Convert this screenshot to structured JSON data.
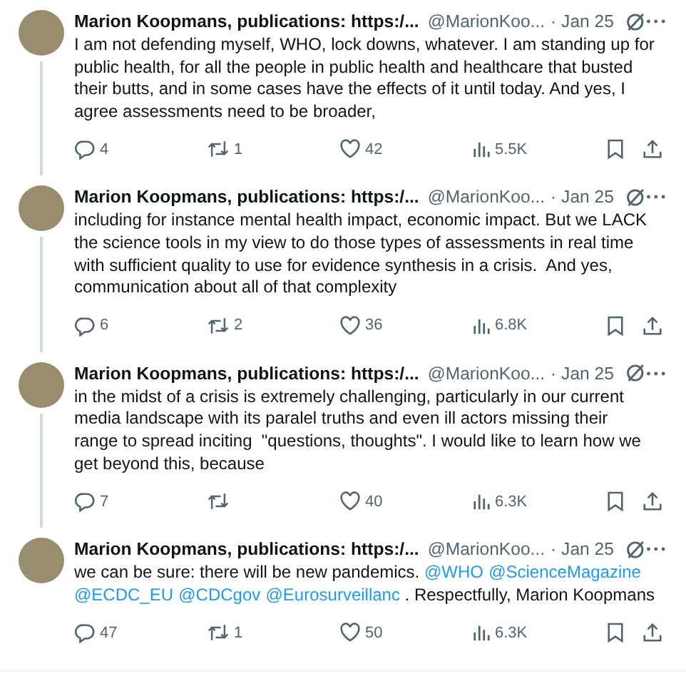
{
  "tweets": [
    {
      "name": "Marion Koopmans, publications: https:/...",
      "handle": "@MarionKoo...",
      "date": "· Jan 25",
      "thread_below": true,
      "body": [
        {
          "kind": "text",
          "text": "I am not defending myself, WHO, lock downs, whatever. I am standing up for public health, for all the people in public health and healthcare that busted their butts, and in some cases have the effects of it until today. And yes, I agree assessments need to be broader,"
        }
      ],
      "replies": "4",
      "reposts": "1",
      "likes": "42",
      "views": "5.5K"
    },
    {
      "name": "Marion Koopmans, publications: https:/...",
      "handle": "@MarionKoo...",
      "date": "· Jan 25",
      "thread_below": true,
      "body": [
        {
          "kind": "text",
          "text": "including for instance mental health impact, economic impact. But we LACK the science tools in my view to do those types of assessments in real time with sufficient quality to use for evidence synthesis in a crisis.  And yes, communication about all of that complexity"
        }
      ],
      "replies": "6",
      "reposts": "2",
      "likes": "36",
      "views": "6.8K"
    },
    {
      "name": "Marion Koopmans, publications: https:/...",
      "handle": "@MarionKoo...",
      "date": "· Jan 25",
      "thread_below": true,
      "body": [
        {
          "kind": "text",
          "text": "in the midst of a crisis is extremely challenging, particularly in our current media landscape with its paralel truths and even ill actors missing their range to spread inciting  \"questions, thoughts\". I would like to learn how we get beyond this, because"
        }
      ],
      "replies": "7",
      "likes": "40",
      "views": "6.3K"
    },
    {
      "name": "Marion Koopmans, publications: https:/...",
      "handle": "@MarionKoo...",
      "date": "· Jan 25",
      "thread_below": false,
      "body": [
        {
          "kind": "text",
          "text": "we can be sure: there will be new pandemics. "
        },
        {
          "kind": "mention",
          "text": "@WHO"
        },
        {
          "kind": "mention",
          "text": "@ScienceMagazine"
        },
        {
          "kind": "mention",
          "text": "@ECDC_EU"
        },
        {
          "kind": "mention",
          "text": "@CDCgov"
        },
        {
          "kind": "mention",
          "text": "@Eurosurveillanc"
        },
        {
          "kind": "text",
          "text": " . Respectfully, Marion Koopmans"
        }
      ],
      "replies": "47",
      "reposts": "1",
      "likes": "50",
      "views": "6.3K"
    }
  ]
}
